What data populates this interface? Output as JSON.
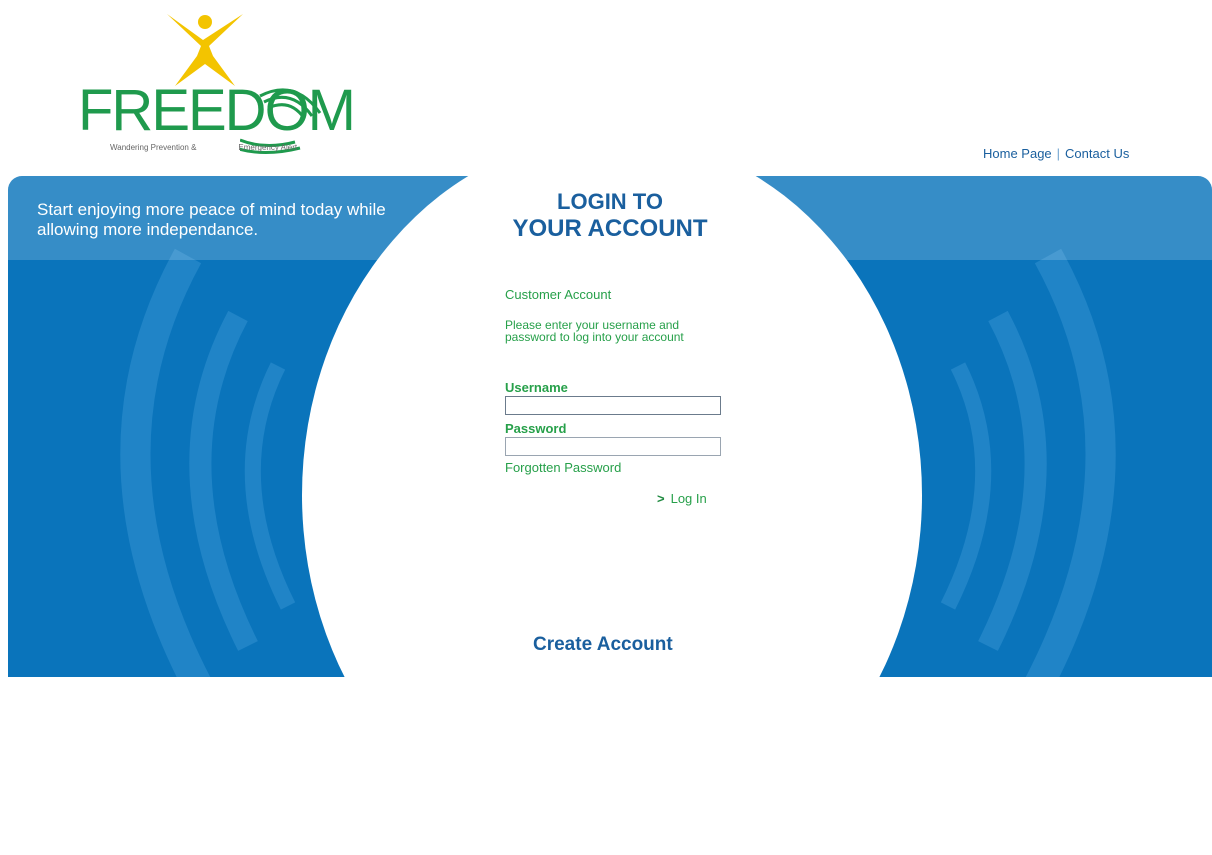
{
  "brand": {
    "logo_text": "FREEDOM",
    "tagline_left": "Wandering Prevention &",
    "tagline_right": "Emergency Alert",
    "green": "#1f9a4d",
    "yellow": "#f3c400"
  },
  "top_links": {
    "home": "Home Page",
    "separator": "|",
    "contact": "Contact Us"
  },
  "hero": {
    "tagline": "Start enjoying more peace of mind today while allowing more independance.",
    "panel_color": "#0a74bb"
  },
  "login": {
    "title_line1": "LOGIN TO",
    "title_line2": "YOUR ACCOUNT",
    "section_title": "Customer Account",
    "instructions": "Please enter your username and password to log into your account",
    "username_label": "Username",
    "username_value": "",
    "password_label": "Password",
    "password_value": "",
    "forgot_label": "Forgotten Password",
    "login_label": "Log In",
    "login_arrow": ">"
  },
  "create_account": {
    "label": "Create Account"
  },
  "icons": {
    "logo_figure": "person-icon",
    "logo_waves": "signal-waves-icon",
    "login_arrow": "chevron-right-icon"
  }
}
